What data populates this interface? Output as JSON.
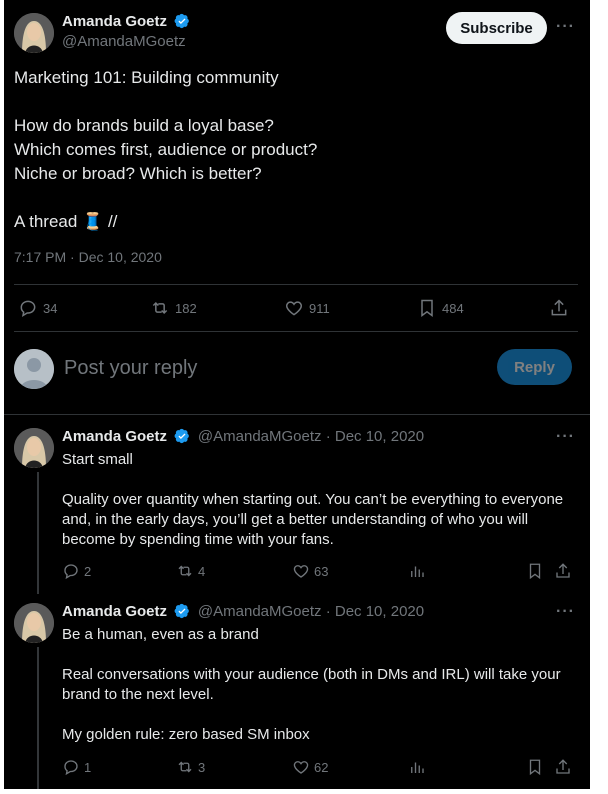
{
  "tweet": {
    "author_name": "Amanda Goetz",
    "author_handle": "@AmandaMGoetz",
    "subscribe_label": "Subscribe",
    "text": "Marketing 101: Building community\n\nHow do brands build a loyal base?\nWhich comes first, audience or product?\nNiche or broad? Which is better?\n\nA thread 🧵 //",
    "timestamp": "7:17 PM · Dec 10, 2020",
    "replies": "34",
    "retweets": "182",
    "likes": "911",
    "bookmarks": "484"
  },
  "reply_box": {
    "placeholder": "Post your reply",
    "button_label": "Reply"
  },
  "replies": [
    {
      "author_name": "Amanda Goetz",
      "meta": "@AmandaMGoetz · Dec 10, 2020",
      "text": "Start small\n\nQuality over quantity when starting out. You can’t be everything to everyone and, in the early days, you’ll get a better understanding of who you will become by spending time with your fans.",
      "replies": "2",
      "retweets": "4",
      "likes": "63"
    },
    {
      "author_name": "Amanda Goetz",
      "meta": "@AmandaMGoetz · Dec 10, 2020",
      "text": "Be a human, even as a brand\n\nReal conversations with your audience (both in DMs and IRL) will take your brand to the next level.\n\nMy golden rule: zero based SM inbox",
      "replies": "1",
      "retweets": "3",
      "likes": "62"
    }
  ],
  "icons": {
    "verified": "verified-badge-icon",
    "reply": "reply-icon",
    "retweet": "retweet-icon",
    "like": "heart-icon",
    "bookmark": "bookmark-icon",
    "share": "share-icon",
    "views": "views-icon",
    "more": "more-icon"
  },
  "colors": {
    "background": "#000000",
    "accent": "#1d9bf0",
    "muted_text": "#71767b",
    "text": "#e7e9ea"
  }
}
